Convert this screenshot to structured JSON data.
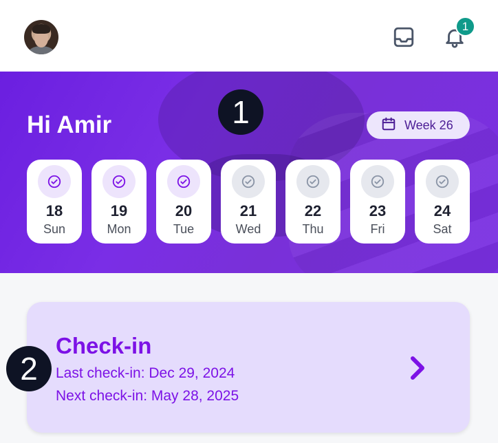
{
  "header": {
    "notification_count": "1"
  },
  "markers": [
    "1",
    "2"
  ],
  "hero": {
    "greeting": "Hi Amir",
    "week_label": "Week 26"
  },
  "days": [
    {
      "num": "18",
      "name": "Sun",
      "status": "done"
    },
    {
      "num": "19",
      "name": "Mon",
      "status": "done"
    },
    {
      "num": "20",
      "name": "Tue",
      "status": "done"
    },
    {
      "num": "21",
      "name": "Wed",
      "status": "todo"
    },
    {
      "num": "22",
      "name": "Thu",
      "status": "todo"
    },
    {
      "num": "23",
      "name": "Fri",
      "status": "todo"
    },
    {
      "num": "24",
      "name": "Sat",
      "status": "todo"
    }
  ],
  "checkin": {
    "title": "Check-in",
    "last": "Last check-in: Dec 29, 2024",
    "next": "Next check-in: May 28, 2025"
  },
  "colors": {
    "accent": "#7c12e6",
    "badge": "#0f9a8a",
    "done": "#7c12e6",
    "todo": "#8a94a6"
  }
}
